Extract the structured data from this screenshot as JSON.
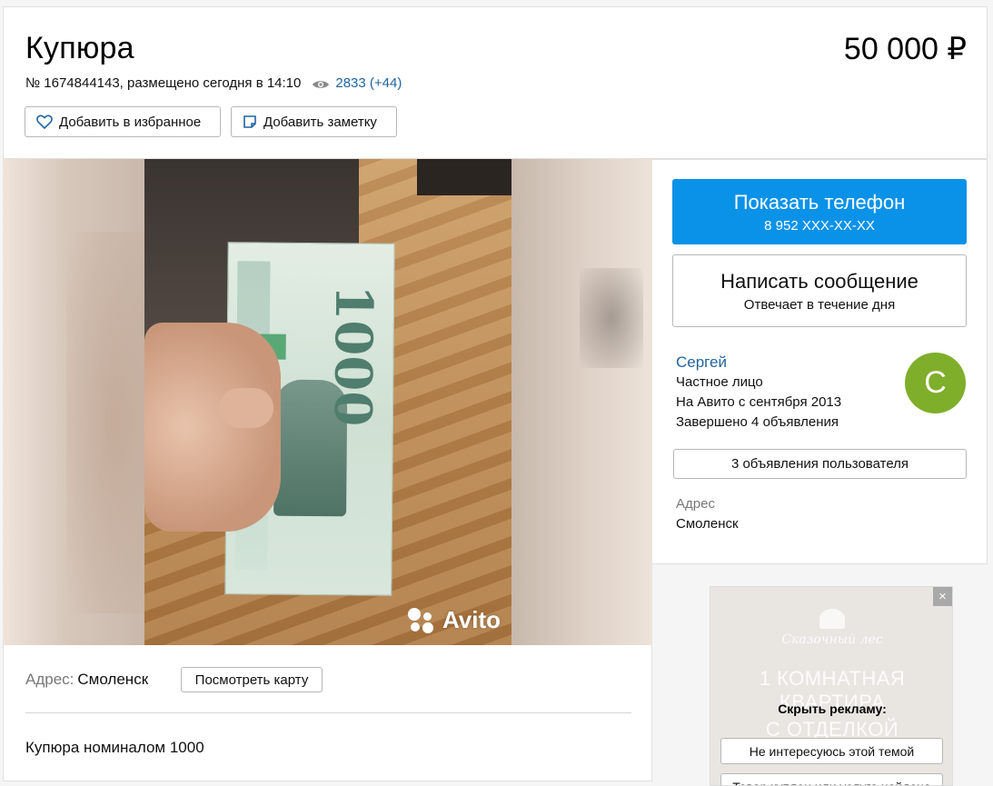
{
  "listing": {
    "title": "Купюра",
    "price": "50 000 ₽",
    "meta": "№ 1674844143, размещено сегодня в 14:10",
    "views": "2833 (+44)"
  },
  "actions": {
    "favorite_label": "Добавить в избранное",
    "note_label": "Добавить заметку"
  },
  "gallery": {
    "watermark": "Avito"
  },
  "details": {
    "address_label": "Адрес:",
    "address_value": "Смоленск",
    "map_button": "Посмотреть карту",
    "description": "Купюра номиналом 1000"
  },
  "contact": {
    "phone_button": "Показать телефон",
    "phone_masked": "8 952 XXX-XX-XX",
    "message_button": "Написать сообщение",
    "message_hint": "Отвечает в течение дня"
  },
  "seller": {
    "name": "Сергей",
    "type": "Частное лицо",
    "since": "На Авито с сентября 2013",
    "completed": "Завершено 4 объявления",
    "avatar_letter": "С",
    "ads_button": "3 объявления пользователя",
    "address_label": "Адрес",
    "address_value": "Смоленск"
  },
  "ad": {
    "brand": "Сказочный лес",
    "line1": "1 КОМНАТНАЯ",
    "line2": "КВАРТИРА",
    "line3": "С ОТДЕЛКОЙ",
    "hide_title": "Скрыть рекламу:",
    "option1": "Не интересуюсь этой темой",
    "option2": "Товар куплен или услуга найдена",
    "close_glyph": "×"
  },
  "colors": {
    "phone_button": "#0a92e8",
    "link": "#2164a1",
    "avatar": "#7fae2b"
  },
  "icons": [
    "eye-icon",
    "heart-icon",
    "note-icon",
    "close-icon",
    "avito-logo-icon"
  ]
}
